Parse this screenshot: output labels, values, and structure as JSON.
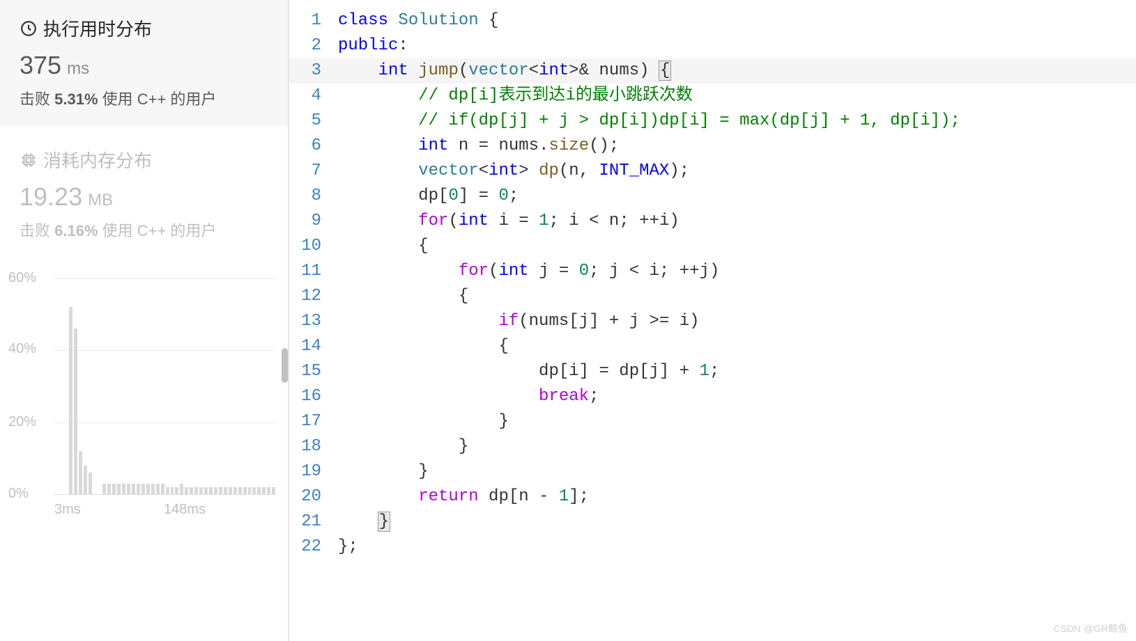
{
  "runtime": {
    "title": "执行用时分布",
    "value": "375",
    "unit": "ms",
    "beat_prefix": "击败 ",
    "beat_pct": "5.31%",
    "beat_suffix": " 使用 C++ 的用户"
  },
  "memory": {
    "title": "消耗内存分布",
    "value": "19.23",
    "unit": "MB",
    "beat_prefix": "击败 ",
    "beat_pct": "6.16%",
    "beat_suffix": " 使用 C++ 的用户"
  },
  "chart_data": {
    "type": "bar",
    "ylabel_pct": true,
    "y_ticks": [
      "60%",
      "40%",
      "20%",
      "0%"
    ],
    "x_ticks": [
      "3ms",
      "148ms"
    ],
    "categories_count": 46,
    "values_pct": [
      0,
      0,
      0,
      52,
      46,
      12,
      8,
      6,
      0,
      0,
      3,
      3,
      3,
      3,
      3,
      3,
      3,
      3,
      3,
      3,
      3,
      3,
      3,
      2,
      2,
      2,
      3,
      2,
      2,
      2,
      2,
      2,
      2,
      2,
      2,
      2,
      2,
      2,
      2,
      2,
      2,
      2,
      2,
      2,
      2,
      2
    ]
  },
  "code": {
    "lines": [
      {
        "n": "1",
        "tokens": [
          [
            "kw",
            "class"
          ],
          [
            "",
            " "
          ],
          [
            "type",
            "Solution"
          ],
          [
            "",
            " "
          ],
          [
            "paren",
            "{"
          ]
        ]
      },
      {
        "n": "2",
        "tokens": [
          [
            "kw",
            "public"
          ],
          [
            "",
            ":"
          ]
        ]
      },
      {
        "n": "3",
        "hl": true,
        "tokens": [
          [
            "",
            "    "
          ],
          [
            "kw",
            "int"
          ],
          [
            "",
            " "
          ],
          [
            "fn",
            "jump"
          ],
          [
            "paren",
            "("
          ],
          [
            "type",
            "vector"
          ],
          [
            "paren",
            "<"
          ],
          [
            "kw",
            "int"
          ],
          [
            "paren",
            ">"
          ],
          [
            "op",
            "&"
          ],
          [
            "",
            " nums"
          ],
          [
            "paren",
            ")"
          ],
          [
            "",
            " "
          ],
          [
            "brace-hl",
            "{"
          ]
        ]
      },
      {
        "n": "4",
        "tokens": [
          [
            "",
            "        "
          ],
          [
            "cm",
            "// dp[i]表示到达i的最小跳跃次数"
          ]
        ]
      },
      {
        "n": "5",
        "tokens": [
          [
            "",
            "        "
          ],
          [
            "cm",
            "// if(dp[j] + j > dp[i])dp[i] = max(dp[j] + 1, dp[i]);"
          ]
        ]
      },
      {
        "n": "6",
        "tokens": [
          [
            "",
            "        "
          ],
          [
            "kw",
            "int"
          ],
          [
            "",
            " n "
          ],
          [
            "op",
            "="
          ],
          [
            "",
            " nums."
          ],
          [
            "fn",
            "size"
          ],
          [
            "paren",
            "()"
          ],
          [
            "",
            ";"
          ]
        ]
      },
      {
        "n": "7",
        "tokens": [
          [
            "",
            "        "
          ],
          [
            "type",
            "vector"
          ],
          [
            "paren",
            "<"
          ],
          [
            "kw",
            "int"
          ],
          [
            "paren",
            ">"
          ],
          [
            "",
            " "
          ],
          [
            "fn",
            "dp"
          ],
          [
            "paren",
            "("
          ],
          [
            "",
            "n, "
          ],
          [
            "const",
            "INT_MAX"
          ],
          [
            "paren",
            ")"
          ],
          [
            "",
            ";"
          ]
        ]
      },
      {
        "n": "8",
        "tokens": [
          [
            "",
            "        dp"
          ],
          [
            "paren",
            "["
          ],
          [
            "num",
            "0"
          ],
          [
            "paren",
            "]"
          ],
          [
            "",
            " "
          ],
          [
            "op",
            "="
          ],
          [
            "",
            " "
          ],
          [
            "num",
            "0"
          ],
          [
            "",
            ";"
          ]
        ]
      },
      {
        "n": "9",
        "tokens": [
          [
            "",
            "        "
          ],
          [
            "pk",
            "for"
          ],
          [
            "paren",
            "("
          ],
          [
            "kw",
            "int"
          ],
          [
            "",
            " i "
          ],
          [
            "op",
            "="
          ],
          [
            "",
            " "
          ],
          [
            "num",
            "1"
          ],
          [
            "",
            "; i "
          ],
          [
            "op",
            "<"
          ],
          [
            "",
            " n; "
          ],
          [
            "op",
            "++"
          ],
          [
            "",
            "i"
          ],
          [
            "paren",
            ")"
          ]
        ]
      },
      {
        "n": "10",
        "tokens": [
          [
            "",
            "        "
          ],
          [
            "paren",
            "{"
          ]
        ]
      },
      {
        "n": "11",
        "tokens": [
          [
            "",
            "            "
          ],
          [
            "pk",
            "for"
          ],
          [
            "paren",
            "("
          ],
          [
            "kw",
            "int"
          ],
          [
            "",
            " j "
          ],
          [
            "op",
            "="
          ],
          [
            "",
            " "
          ],
          [
            "num",
            "0"
          ],
          [
            "",
            "; j "
          ],
          [
            "op",
            "<"
          ],
          [
            "",
            " i; "
          ],
          [
            "op",
            "++"
          ],
          [
            "",
            "j"
          ],
          [
            "paren",
            ")"
          ]
        ]
      },
      {
        "n": "12",
        "tokens": [
          [
            "",
            "            "
          ],
          [
            "paren",
            "{"
          ]
        ]
      },
      {
        "n": "13",
        "tokens": [
          [
            "",
            "                "
          ],
          [
            "pk",
            "if"
          ],
          [
            "paren",
            "("
          ],
          [
            "",
            "nums"
          ],
          [
            "paren",
            "["
          ],
          [
            "",
            "j"
          ],
          [
            "paren",
            "]"
          ],
          [
            "",
            " "
          ],
          [
            "op",
            "+"
          ],
          [
            "",
            " j "
          ],
          [
            "op",
            ">="
          ],
          [
            "",
            " i"
          ],
          [
            "paren",
            ")"
          ]
        ]
      },
      {
        "n": "14",
        "tokens": [
          [
            "",
            "                "
          ],
          [
            "paren",
            "{"
          ]
        ]
      },
      {
        "n": "15",
        "tokens": [
          [
            "",
            "                    dp"
          ],
          [
            "paren",
            "["
          ],
          [
            "",
            "i"
          ],
          [
            "paren",
            "]"
          ],
          [
            "",
            " "
          ],
          [
            "op",
            "="
          ],
          [
            "",
            " dp"
          ],
          [
            "paren",
            "["
          ],
          [
            "",
            "j"
          ],
          [
            "paren",
            "]"
          ],
          [
            "",
            " "
          ],
          [
            "op",
            "+"
          ],
          [
            "",
            " "
          ],
          [
            "num",
            "1"
          ],
          [
            "",
            ";"
          ]
        ]
      },
      {
        "n": "16",
        "tokens": [
          [
            "",
            "                    "
          ],
          [
            "pk",
            "break"
          ],
          [
            "",
            ";"
          ]
        ]
      },
      {
        "n": "17",
        "tokens": [
          [
            "",
            "                "
          ],
          [
            "paren",
            "}"
          ]
        ]
      },
      {
        "n": "18",
        "tokens": [
          [
            "",
            "            "
          ],
          [
            "paren",
            "}"
          ]
        ]
      },
      {
        "n": "19",
        "tokens": [
          [
            "",
            "        "
          ],
          [
            "paren",
            "}"
          ]
        ]
      },
      {
        "n": "20",
        "tokens": [
          [
            "",
            "        "
          ],
          [
            "pk",
            "return"
          ],
          [
            "",
            " dp"
          ],
          [
            "paren",
            "["
          ],
          [
            "",
            "n "
          ],
          [
            "op",
            "-"
          ],
          [
            "",
            " "
          ],
          [
            "num",
            "1"
          ],
          [
            "paren",
            "]"
          ],
          [
            "",
            ";"
          ]
        ]
      },
      {
        "n": "21",
        "tokens": [
          [
            "",
            "    "
          ],
          [
            "brace-hl",
            "}"
          ]
        ]
      },
      {
        "n": "22",
        "tokens": [
          [
            "paren",
            "}"
          ],
          [
            "",
            ";"
          ]
        ]
      }
    ]
  },
  "watermark": "CSDN @GR鲸鱼"
}
